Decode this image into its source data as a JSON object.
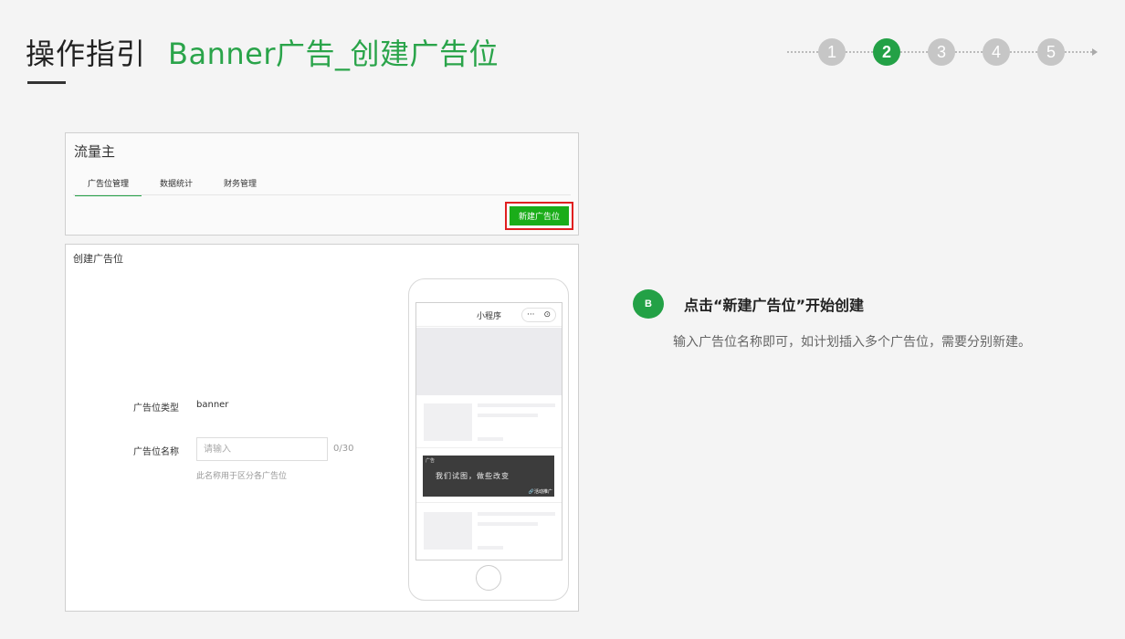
{
  "header": {
    "title": "操作指引",
    "subtitle": "Banner广告_创建广告位"
  },
  "steps": {
    "items": [
      "1",
      "2",
      "3",
      "4",
      "5"
    ],
    "active_index": 1,
    "active_color": "#23a146",
    "inactive_color": "#c6c6c6"
  },
  "panel_top": {
    "title": "流量主",
    "tabs": [
      "广告位管理",
      "数据统计",
      "财务管理"
    ],
    "new_button_label": "新建广告位"
  },
  "panel_form": {
    "title": "创建广告位",
    "type_label": "广告位类型",
    "type_value": "banner",
    "name_label": "广告位名称",
    "name_placeholder": "请输入",
    "name_counter": "0/30",
    "name_hint": "此名称用于区分各广告位"
  },
  "phone": {
    "nav_title": "小程序",
    "capsule_more": "···",
    "capsule_close": "⊙",
    "ad_tag": "广告",
    "ad_text": "我们试图，做些改变",
    "ad_link": "🔗活动推广"
  },
  "guide": {
    "badge": "B",
    "heading": "点击“新建广告位”开始创建",
    "description": "输入广告位名称即可，如计划插入多个广告位，需要分别新建。"
  }
}
